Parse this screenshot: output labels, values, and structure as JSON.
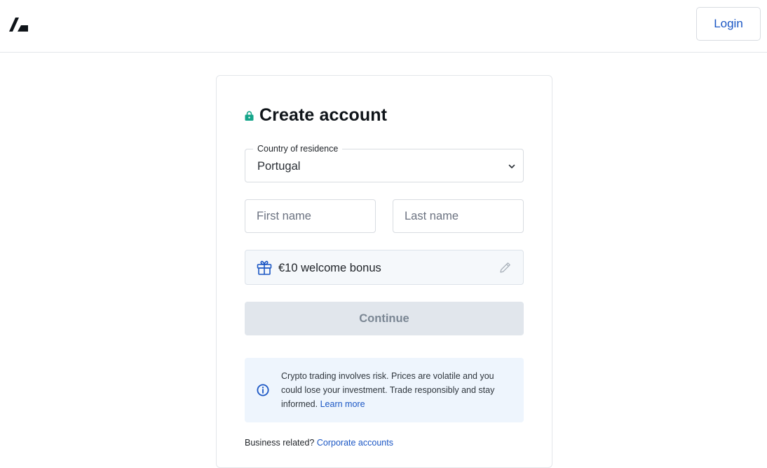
{
  "header": {
    "logo_icon": "brand-slash-logo",
    "login_label": "Login"
  },
  "form": {
    "title": "Create account",
    "title_icon": "lock-icon",
    "country": {
      "label": "Country of residence",
      "value": "Portugal"
    },
    "first_name": {
      "placeholder": "First name",
      "value": ""
    },
    "last_name": {
      "placeholder": "Last name",
      "value": ""
    },
    "bonus": {
      "icon": "gift-icon",
      "text": "€10 welcome bonus",
      "edit_icon": "pencil-icon"
    },
    "continue_label": "Continue",
    "risk_notice": {
      "icon": "info-icon",
      "text": "Crypto trading involves risk. Prices are volatile and you could lose your investment. Trade responsibly and stay informed.",
      "link_label": "Learn more"
    },
    "business": {
      "text": "Business related?",
      "link_label": "Corporate accounts"
    }
  },
  "colors": {
    "accent": "#1a56c4",
    "lock": "#14a58a",
    "disabled_button_bg": "#e1e6ec",
    "notice_bg": "#eef5fd"
  }
}
